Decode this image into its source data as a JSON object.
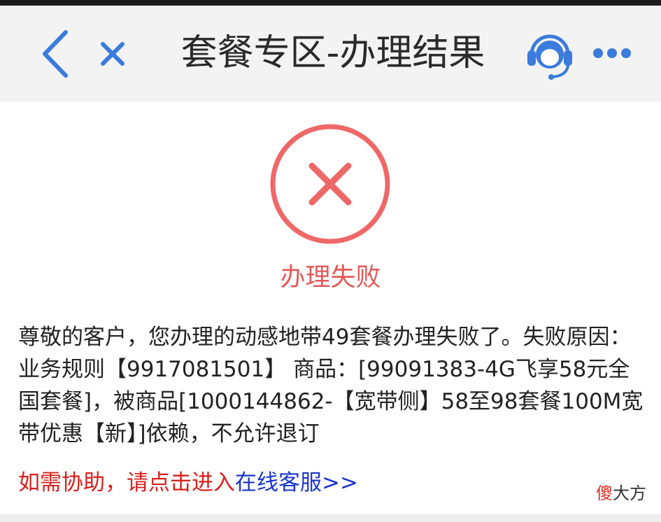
{
  "header": {
    "title": "套餐专区-办理结果",
    "icons": {
      "back": "chevron-left-icon",
      "close": "close-icon",
      "service": "customer-service-headset-icon",
      "more": "more-dots-icon"
    }
  },
  "result": {
    "status_text": "办理失败",
    "icon": "fail-x-circle-icon",
    "message": "尊敬的客户，您办理的动感地带49套餐办理失败了。失败原因：业务规则【9917081501】 商品：[99091383-4G飞享58元全国套餐]，被商品[1000144862-【宽带侧】58至98套餐100M宽带优惠【新】]依赖，不允许退订"
  },
  "help": {
    "prefix": "如需协助，请点击进入",
    "link_text": "在线客服>>"
  },
  "watermark": {
    "accent": "傻",
    "rest": "大方"
  },
  "colors": {
    "header_bg": "#f3f3f3",
    "icon_blue": "#3a7bdc",
    "fail_red": "#e05a5a",
    "help_red": "#d7201b",
    "link_blue": "#1a35c8"
  }
}
